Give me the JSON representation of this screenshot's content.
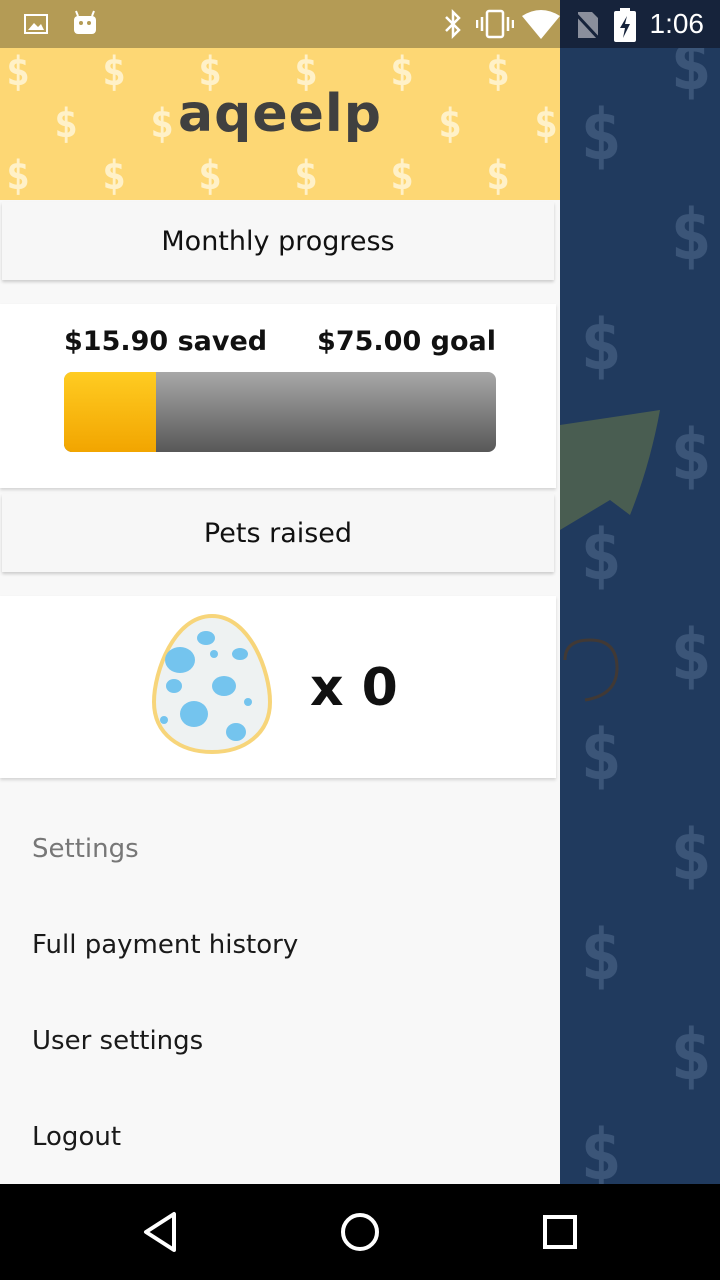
{
  "status_bar": {
    "time": "1:06",
    "left_icons": [
      "image-icon",
      "android-icon"
    ],
    "right_icons": [
      "bluetooth-icon",
      "vibrate-icon",
      "wifi-icon",
      "no-sim-icon",
      "battery-charging-icon"
    ]
  },
  "drawer": {
    "logo_text": "aqeelp",
    "monthly_progress": {
      "title": "Monthly progress",
      "saved_label": "$15.90 saved",
      "goal_label": "$75.00 goal",
      "saved": 15.9,
      "goal": 75.0
    },
    "pets": {
      "title": "Pets raised",
      "count_label": "x 0",
      "icon": "egg-icon"
    },
    "menu": {
      "header": "Settings",
      "items": [
        "Full payment history",
        "User settings",
        "Logout"
      ]
    }
  },
  "nav_bar": {
    "icons": [
      "back-icon",
      "home-icon",
      "recents-icon"
    ]
  },
  "colors": {
    "header_yellow": "#fdd774",
    "background_navy": "#203a5e",
    "progress_fill": "#ffc107",
    "progress_track": "#7a7a7a"
  }
}
